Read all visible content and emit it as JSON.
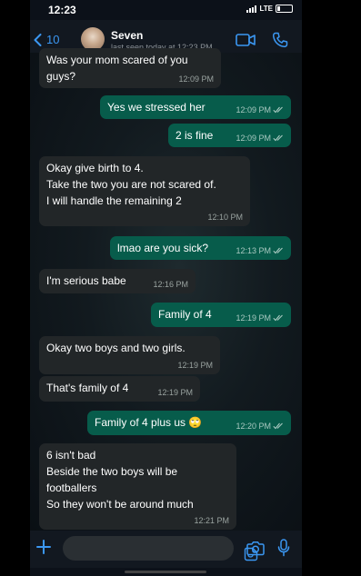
{
  "status": {
    "time": "12:23",
    "network": "LTE"
  },
  "header": {
    "back_count": "10",
    "contact_name": "Seven",
    "last_seen": "last seen today at 12:23 PM"
  },
  "messages": [
    {
      "dir": "in",
      "lines": [
        "Was your mom scared of you",
        "guys?"
      ],
      "time": "12:09 PM"
    },
    {
      "dir": "out",
      "lines": [
        "Yes we stressed her"
      ],
      "time": "12:09 PM"
    },
    {
      "dir": "out",
      "lines": [
        "2 is fine"
      ],
      "time": "12:09 PM"
    },
    {
      "dir": "in",
      "lines": [
        "Okay give birth to 4.",
        "Take the two you are not scared of.",
        "I will handle the remaining 2"
      ],
      "time": "12:10 PM"
    },
    {
      "dir": "out",
      "lines": [
        "lmao are you sick?"
      ],
      "time": "12:13 PM"
    },
    {
      "dir": "in",
      "lines": [
        "I'm serious babe"
      ],
      "time": "12:16 PM"
    },
    {
      "dir": "out",
      "lines": [
        "Family of 4"
      ],
      "time": "12:19 PM"
    },
    {
      "dir": "in",
      "lines": [
        "Okay two boys and two girls."
      ],
      "time": "12:19 PM"
    },
    {
      "dir": "in",
      "lines": [
        "That's family of 4"
      ],
      "time": "12:19 PM"
    },
    {
      "dir": "out",
      "lines": [
        "Family of 4 plus us 🙄"
      ],
      "time": "12:20 PM"
    },
    {
      "dir": "in",
      "lines": [
        "6 isn't bad",
        "Beside the two boys will be",
        "footballers",
        "So they won't be around much"
      ],
      "time": "12:21 PM"
    }
  ],
  "icons": {
    "back": "chevron-left-icon",
    "video": "video-call-icon",
    "call": "phone-call-icon",
    "plus": "plus-icon",
    "sticker": "sticker-icon",
    "camera": "camera-icon",
    "mic": "microphone-icon",
    "read": "double-check-icon"
  },
  "colors": {
    "accent": "#3b97f2",
    "outgoing": "#075c4b",
    "incoming": "#222628"
  }
}
